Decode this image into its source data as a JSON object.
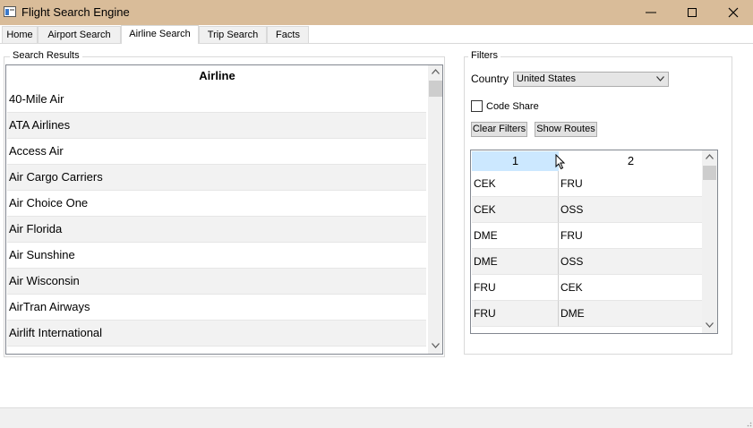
{
  "window": {
    "title": "Flight Search Engine",
    "titlebar_color": "#d9bc99"
  },
  "tabs": [
    {
      "label": "Home",
      "active": false
    },
    {
      "label": "Airport Search",
      "active": false
    },
    {
      "label": "Airline Search",
      "active": true
    },
    {
      "label": "Trip Search",
      "active": false
    },
    {
      "label": "Facts",
      "active": false
    }
  ],
  "results": {
    "group_label": "Search Results",
    "column_header": "Airline",
    "rows": [
      "40-Mile Air",
      "ATA Airlines",
      "Access Air",
      "Air Cargo Carriers",
      "Air Choice One",
      "Air Florida",
      "Air Sunshine",
      "Air Wisconsin",
      "AirTran Airways",
      "Airlift International"
    ]
  },
  "filters": {
    "group_label": "Filters",
    "country_label": "Country",
    "country_value": "United States",
    "code_share_label": "Code Share",
    "code_share_checked": false,
    "clear_button": "Clear Filters",
    "routes_button": "Show Routes"
  },
  "routes": {
    "headers": [
      "1",
      "2"
    ],
    "selected_header_color": "#cce8ff",
    "rows": [
      [
        "CEK",
        "FRU"
      ],
      [
        "CEK",
        "OSS"
      ],
      [
        "DME",
        "FRU"
      ],
      [
        "DME",
        "OSS"
      ],
      [
        "FRU",
        "CEK"
      ],
      [
        "FRU",
        "DME"
      ]
    ]
  }
}
